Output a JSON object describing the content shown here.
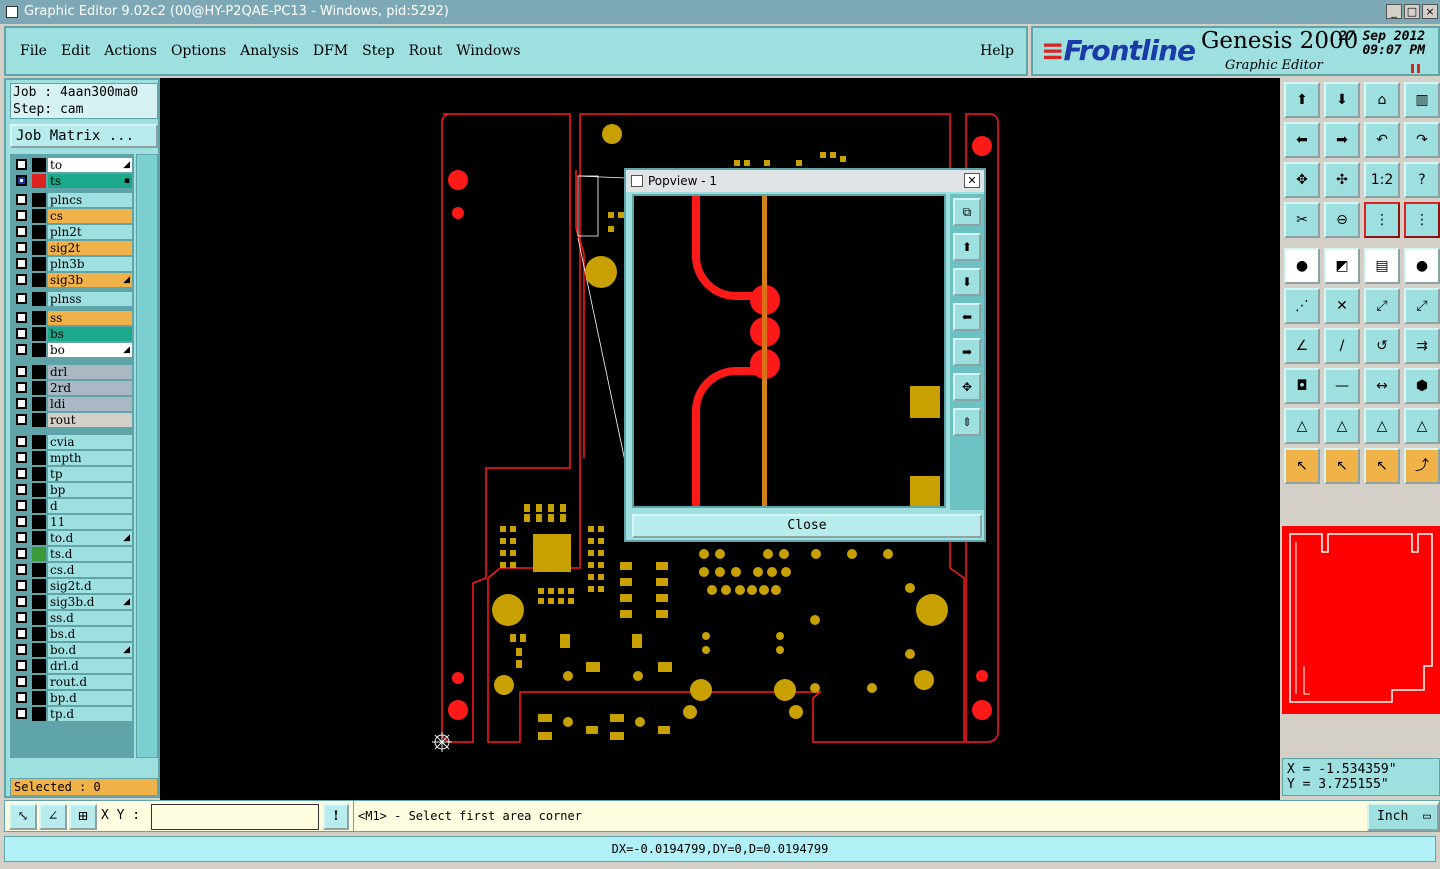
{
  "window": {
    "title": "Graphic Editor 9.02c2 (00@HY-P2QAE-PC13 - Windows, pid:5292)",
    "controls": [
      "_",
      "□",
      "×"
    ]
  },
  "menu": {
    "items": [
      "File",
      "Edit",
      "Actions",
      "Options",
      "Analysis",
      "DFM",
      "Step",
      "Rout",
      "Windows"
    ],
    "help": "Help"
  },
  "brand": {
    "logo": "Frontline",
    "product": "Genesis 2000",
    "subtitle": "Graphic Editor",
    "date_line1": "27 Sep 2012",
    "date_line2": "09:07 PM",
    "accent": "#1a3aa8",
    "logo_mark_color": "#dd2222"
  },
  "job": {
    "job_line": "Job : 4aan300ma0",
    "step_line": "Step: cam",
    "matrix_button": "Job Matrix ..."
  },
  "layers": [
    {
      "name": "to",
      "color": "#ffffff",
      "swatch": "#000000",
      "checked": false,
      "mark": "◢"
    },
    {
      "name": "ts",
      "color": "#1aa98a",
      "swatch": "#dd2222",
      "checked": true,
      "mark": "▪"
    },
    {
      "name": "plncs",
      "color": "#9edfe0",
      "swatch": "#000000",
      "checked": false,
      "mark": ""
    },
    {
      "name": "cs",
      "color": "#f2b24a",
      "swatch": "#000000",
      "checked": false,
      "mark": ""
    },
    {
      "name": "pln2t",
      "color": "#9edfe0",
      "swatch": "#000000",
      "checked": false,
      "mark": ""
    },
    {
      "name": "sig2t",
      "color": "#f2b24a",
      "swatch": "#000000",
      "checked": false,
      "mark": ""
    },
    {
      "name": "pln3b",
      "color": "#9edfe0",
      "swatch": "#000000",
      "checked": false,
      "mark": ""
    },
    {
      "name": "sig3b",
      "color": "#f2b24a",
      "swatch": "#000000",
      "checked": false,
      "mark": "◢"
    },
    {
      "name": "plnss",
      "color": "#9edfe0",
      "swatch": "#000000",
      "checked": false,
      "mark": ""
    },
    {
      "name": "ss",
      "color": "#f2b24a",
      "swatch": "#000000",
      "checked": false,
      "mark": ""
    },
    {
      "name": "bs",
      "color": "#1aa98a",
      "swatch": "#000000",
      "checked": false,
      "mark": ""
    },
    {
      "name": "bo",
      "color": "#ffffff",
      "swatch": "#000000",
      "checked": false,
      "mark": "◢"
    },
    {
      "name": "drl",
      "color": "#a9b8c2",
      "swatch": "#000000",
      "checked": false,
      "mark": ""
    },
    {
      "name": "2rd",
      "color": "#a9b8c2",
      "swatch": "#000000",
      "checked": false,
      "mark": ""
    },
    {
      "name": "ldi",
      "color": "#a9b8c2",
      "swatch": "#000000",
      "checked": false,
      "mark": ""
    },
    {
      "name": "rout",
      "color": "#d4d0c8",
      "swatch": "#000000",
      "checked": false,
      "mark": ""
    },
    {
      "name": "cvia",
      "color": "#9edfe0",
      "swatch": "#000000",
      "checked": false,
      "mark": ""
    },
    {
      "name": "mpth",
      "color": "#9edfe0",
      "swatch": "#000000",
      "checked": false,
      "mark": ""
    },
    {
      "name": "tp",
      "color": "#9edfe0",
      "swatch": "#000000",
      "checked": false,
      "mark": ""
    },
    {
      "name": "bp",
      "color": "#9edfe0",
      "swatch": "#000000",
      "checked": false,
      "mark": ""
    },
    {
      "name": "d",
      "color": "#9edfe0",
      "swatch": "#000000",
      "checked": false,
      "mark": ""
    },
    {
      "name": "11",
      "color": "#9edfe0",
      "swatch": "#000000",
      "checked": false,
      "mark": ""
    },
    {
      "name": "to.d",
      "color": "#9edfe0",
      "swatch": "#000000",
      "checked": false,
      "mark": "◢"
    },
    {
      "name": "ts.d",
      "color": "#9edfe0",
      "swatch": "#3a9a3a",
      "checked": false,
      "mark": ""
    },
    {
      "name": "cs.d",
      "color": "#9edfe0",
      "swatch": "#000000",
      "checked": false,
      "mark": ""
    },
    {
      "name": "sig2t.d",
      "color": "#9edfe0",
      "swatch": "#000000",
      "checked": false,
      "mark": ""
    },
    {
      "name": "sig3b.d",
      "color": "#9edfe0",
      "swatch": "#000000",
      "checked": false,
      "mark": "◢"
    },
    {
      "name": "ss.d",
      "color": "#9edfe0",
      "swatch": "#000000",
      "checked": false,
      "mark": ""
    },
    {
      "name": "bs.d",
      "color": "#9edfe0",
      "swatch": "#000000",
      "checked": false,
      "mark": ""
    },
    {
      "name": "bo.d",
      "color": "#9edfe0",
      "swatch": "#000000",
      "checked": false,
      "mark": "◢"
    },
    {
      "name": "drl.d",
      "color": "#9edfe0",
      "swatch": "#000000",
      "checked": false,
      "mark": ""
    },
    {
      "name": "rout.d",
      "color": "#9edfe0",
      "swatch": "#000000",
      "checked": false,
      "mark": ""
    },
    {
      "name": "bp.d",
      "color": "#9edfe0",
      "swatch": "#000000",
      "checked": false,
      "mark": ""
    },
    {
      "name": "tp.d",
      "color": "#9edfe0",
      "swatch": "#000000",
      "checked": false,
      "mark": ""
    }
  ],
  "selected_label": "Selected : 0",
  "popview": {
    "title": "Popview - 1",
    "close_label": "Close",
    "tool_icons": [
      "zoom-window-icon",
      "pan-up-icon",
      "pan-down-icon",
      "pan-left-icon",
      "pan-right-icon",
      "zoom-fit-icon",
      "zoom-home-icon"
    ]
  },
  "toolbar": {
    "icons": [
      "pan-up-icon",
      "pan-down-icon",
      "home-icon",
      "split-view-icon",
      "pan-left-icon",
      "pan-right-icon",
      "undo-view-icon",
      "redo-view-icon",
      "zoom-fit-icon",
      "zoom-center-icon",
      "zoom-1-2-icon",
      "help-icon",
      "measure-icon",
      "probe-icon",
      "layers-red-icon",
      "layers-red-2-icon",
      "add-pad-icon",
      "color-icon",
      "ruler-icon",
      "circle-icon",
      "move-node-icon",
      "delete-node-icon",
      "connect-icon",
      "connect-2-icon",
      "draw-line-icon",
      "draw-line-2-icon",
      "arc-icon",
      "text-icon",
      "pad-select-icon",
      "line-select-icon",
      "resize-icon",
      "shapes-icon",
      "triangle-icon",
      "triangle-2-icon",
      "triangle-3-icon",
      "triangle-4-icon",
      "select-arrow-icon",
      "select-arrow-2-icon",
      "select-arrow-3-icon",
      "route-icon"
    ],
    "labels": {
      "zoom12": "1:2",
      "help": "?"
    }
  },
  "coords": {
    "x_line": "X = -1.534359\"",
    "y_line": "Y = 3.725155\""
  },
  "cmdbar": {
    "xy_label": "X Y :",
    "xy_value": "",
    "bang": "!",
    "prompt": "<M1> - Select first area corner",
    "unit": "Inch"
  },
  "status": "DX=-0.0194799,DY=0,D=0.0194799"
}
